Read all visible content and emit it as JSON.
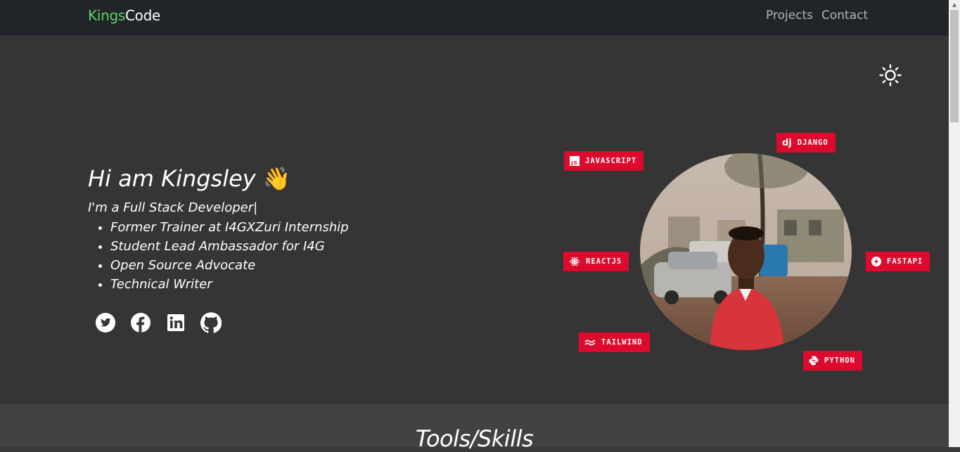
{
  "nav": {
    "brand_part1": "Kings",
    "brand_part2": "Code",
    "links": [
      "Projects",
      "Contact"
    ]
  },
  "theme_toggle_icon": "sun-icon",
  "hero": {
    "greeting": "Hi am Kingsley",
    "wave_emoji": "👋",
    "role": "I'm a Full Stack Developer",
    "cursor": "|",
    "facts": [
      "Former Trainer at I4GXZuri Internship",
      "Student Lead Ambassador for I4G",
      "Open Source Advocate",
      "Technical Writer"
    ],
    "socials": [
      "twitter-icon",
      "facebook-icon",
      "linkedin-icon",
      "github-icon"
    ],
    "skills": [
      {
        "label": "JAVASCRIPT",
        "icon": "javascript-icon"
      },
      {
        "label": "DJANGO",
        "icon": "django-icon",
        "icon_text": "dj"
      },
      {
        "label": "REACTJS",
        "icon": "react-icon"
      },
      {
        "label": "FASTAPI",
        "icon": "fastapi-icon"
      },
      {
        "label": "TAILWIND",
        "icon": "tailwind-icon"
      },
      {
        "label": "PYTHON",
        "icon": "python-icon"
      }
    ]
  },
  "sections": {
    "tools_title": "Tools/Skills"
  },
  "colors": {
    "navbar_bg": "#212529",
    "hero_bg": "#353535",
    "accent_green": "#5fd068",
    "badge_red": "#dc0a2d"
  }
}
